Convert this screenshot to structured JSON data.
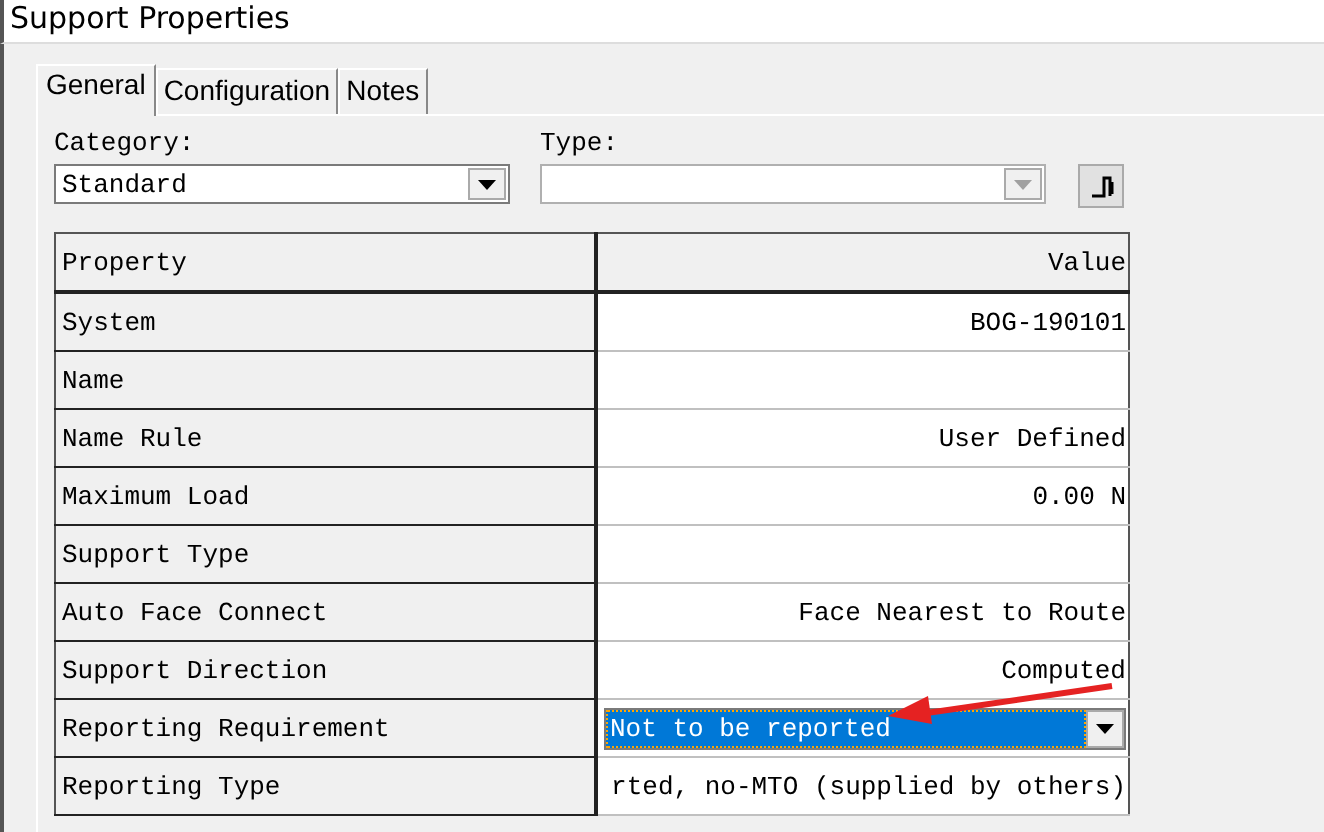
{
  "window": {
    "title": "Support Properties"
  },
  "tabs": [
    {
      "label": "General",
      "selected": true
    },
    {
      "label": "Configuration",
      "selected": false
    },
    {
      "label": "Notes",
      "selected": false
    }
  ],
  "category": {
    "label": "Category:",
    "value": "Standard",
    "disabled": false
  },
  "type": {
    "label": "Type:",
    "disabled": true
  },
  "grid": {
    "columns": [
      "Property",
      "Value"
    ],
    "rows": [
      {
        "property": "System",
        "value": "BOG-190101",
        "kind": "text"
      },
      {
        "property": "Name",
        "kind": "text"
      },
      {
        "property": "Name Rule",
        "value": "User Defined",
        "kind": "text"
      },
      {
        "property": "Maximum Load",
        "value": "0.00 N",
        "kind": "text"
      },
      {
        "property": "Support Type",
        "kind": "text"
      },
      {
        "property": "Auto Face Connect",
        "value": "Face Nearest to Route",
        "kind": "text"
      },
      {
        "property": "Support Direction",
        "value": "Computed",
        "kind": "text"
      },
      {
        "property": "Reporting Requirement",
        "value": "Not to be reported",
        "kind": "dropdown"
      },
      {
        "property": "Reporting Type",
        "value": "rted, no-MTO (supplied by others)",
        "kind": "text"
      }
    ]
  }
}
